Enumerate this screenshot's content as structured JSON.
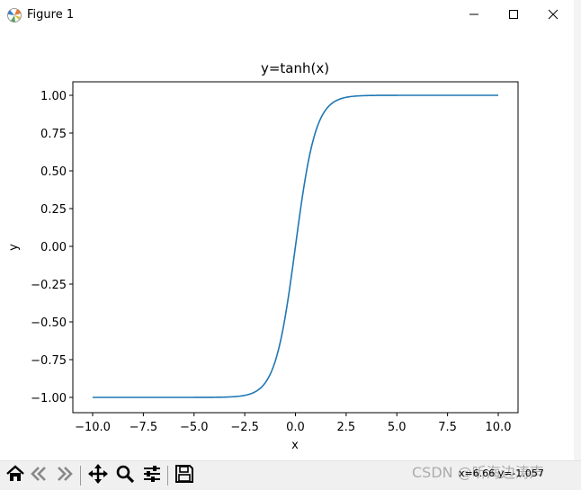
{
  "window": {
    "title": "Figure 1",
    "icon": "matplotlib-logo-icon",
    "controls": [
      "minimize-icon",
      "maximize-icon",
      "close-icon"
    ]
  },
  "colors": {
    "line": "#1f77b4",
    "axes": "#000000",
    "toolbar_bg": "#f0f0f0"
  },
  "chart_data": {
    "type": "line",
    "title": "y=tanh(x)",
    "xlabel": "x",
    "ylabel": "y",
    "xlim": [
      -10.0,
      10.0
    ],
    "ylim": [
      -1.0,
      1.0
    ],
    "xticks": [
      "−10.0",
      "−7.5",
      "−5.0",
      "−2.5",
      "0.0",
      "2.5",
      "5.0",
      "7.5",
      "10.0"
    ],
    "xtick_values": [
      -10,
      -7.5,
      -5,
      -2.5,
      0,
      2.5,
      5,
      7.5,
      10
    ],
    "yticks": [
      "−1.00",
      "−0.75",
      "−0.50",
      "−0.25",
      "0.00",
      "0.25",
      "0.50",
      "0.75",
      "1.00"
    ],
    "ytick_values": [
      -1,
      -0.75,
      -0.5,
      -0.25,
      0,
      0.25,
      0.5,
      0.75,
      1
    ],
    "grid": false,
    "series": [
      {
        "x": [
          -10,
          -8,
          -6,
          -4,
          -3,
          -2.5,
          -2,
          -1.5,
          -1,
          -0.75,
          -0.5,
          -0.25,
          0,
          0.25,
          0.5,
          0.75,
          1,
          1.5,
          2,
          2.5,
          3,
          4,
          6,
          8,
          10
        ],
        "y": [
          -1.0,
          -1.0,
          -1.0,
          -0.9993,
          -0.9951,
          -0.9866,
          -0.964,
          -0.9051,
          -0.7616,
          -0.6351,
          -0.4621,
          -0.2449,
          0.0,
          0.2449,
          0.4621,
          0.6351,
          0.7616,
          0.9051,
          0.964,
          0.9866,
          0.9951,
          0.9993,
          1.0,
          1.0,
          1.0
        ]
      }
    ]
  },
  "toolbar": {
    "items": [
      {
        "name": "home-icon"
      },
      {
        "name": "back-icon"
      },
      {
        "name": "forward-icon"
      },
      {
        "name": "pan-icon"
      },
      {
        "name": "zoom-icon"
      },
      {
        "name": "configure-subplots-icon"
      },
      {
        "name": "save-icon"
      }
    ],
    "coordinates": "x=6.66 y=-1.057"
  },
  "watermark": "CSDN @听海边涛声"
}
